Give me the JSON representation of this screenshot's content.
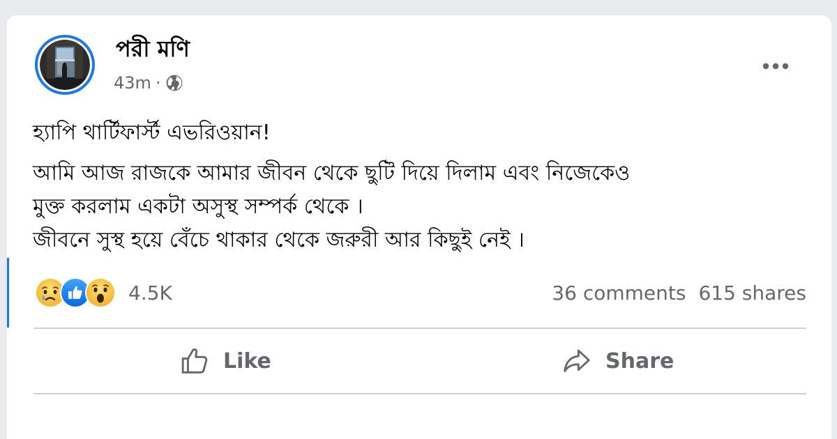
{
  "post": {
    "author_name": "পরী মণি",
    "timestamp": "43m",
    "separator": "·",
    "privacy_icon": "globe-icon",
    "more_icon": "more-dots-icon",
    "lines": [
      "হ্যাপি থার্টিফার্স্ট এভরিওয়ান!",
      "আমি আজ রাজকে আমার জীবন থেকে ছুটি দিয়ে দিলাম এবং নিজেকেও",
      "মুক্ত করলাম একটা অসুস্থ সম্পর্ক থেকে ।",
      "জীবনে সুস্থ হয়ে বেঁচে থাকার থেকে জরুরী আর কিছুই নেই ।"
    ]
  },
  "engagement": {
    "reactions": [
      "sad-reaction-icon",
      "like-reaction-icon",
      "wow-reaction-icon"
    ],
    "reaction_count": "4.5K",
    "comments": "36 comments",
    "shares": "615 shares"
  },
  "actions": {
    "like_label": "Like",
    "share_label": "Share"
  },
  "colors": {
    "accent": "#1877f2",
    "text_primary": "#050505",
    "text_secondary": "#65676b",
    "divider": "#ced0d4",
    "background": "#e9ebee"
  }
}
